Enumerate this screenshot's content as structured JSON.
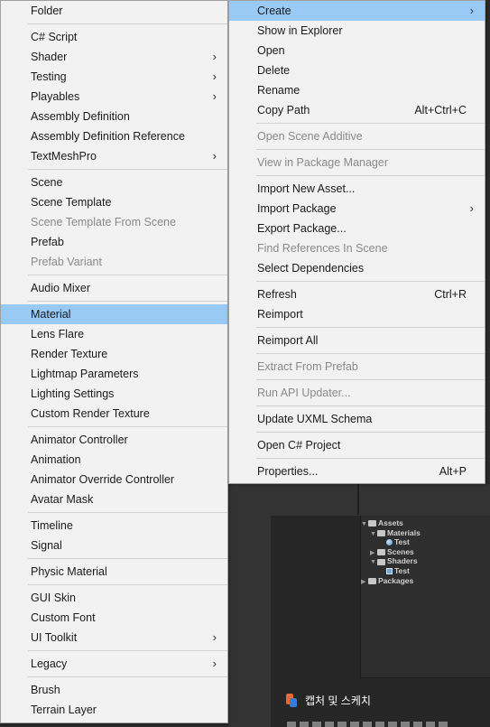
{
  "left_menu": {
    "groups": [
      [
        {
          "label": "Folder"
        }
      ],
      [
        {
          "label": "C# Script"
        },
        {
          "label": "Shader",
          "submenu": true
        },
        {
          "label": "Testing",
          "submenu": true
        },
        {
          "label": "Playables",
          "submenu": true
        },
        {
          "label": "Assembly Definition"
        },
        {
          "label": "Assembly Definition Reference"
        },
        {
          "label": "TextMeshPro",
          "submenu": true
        }
      ],
      [
        {
          "label": "Scene"
        },
        {
          "label": "Scene Template"
        },
        {
          "label": "Scene Template From Scene",
          "disabled": true
        },
        {
          "label": "Prefab"
        },
        {
          "label": "Prefab Variant",
          "disabled": true
        }
      ],
      [
        {
          "label": "Audio Mixer"
        }
      ],
      [
        {
          "label": "Material",
          "selected": true
        },
        {
          "label": "Lens Flare"
        },
        {
          "label": "Render Texture"
        },
        {
          "label": "Lightmap Parameters"
        },
        {
          "label": "Lighting Settings"
        },
        {
          "label": "Custom Render Texture"
        }
      ],
      [
        {
          "label": "Animator Controller"
        },
        {
          "label": "Animation"
        },
        {
          "label": "Animator Override Controller"
        },
        {
          "label": "Avatar Mask"
        }
      ],
      [
        {
          "label": "Timeline"
        },
        {
          "label": "Signal"
        }
      ],
      [
        {
          "label": "Physic Material"
        }
      ],
      [
        {
          "label": "GUI Skin"
        },
        {
          "label": "Custom Font"
        },
        {
          "label": "UI Toolkit",
          "submenu": true
        }
      ],
      [
        {
          "label": "Legacy",
          "submenu": true
        }
      ],
      [
        {
          "label": "Brush"
        },
        {
          "label": "Terrain Layer"
        }
      ]
    ]
  },
  "right_menu": {
    "groups": [
      [
        {
          "label": "Create",
          "submenu": true,
          "selected": true
        },
        {
          "label": "Show in Explorer"
        },
        {
          "label": "Open"
        },
        {
          "label": "Delete"
        },
        {
          "label": "Rename"
        },
        {
          "label": "Copy Path",
          "shortcut": "Alt+Ctrl+C"
        }
      ],
      [
        {
          "label": "Open Scene Additive",
          "disabled": true
        }
      ],
      [
        {
          "label": "View in Package Manager",
          "disabled": true
        }
      ],
      [
        {
          "label": "Import New Asset..."
        },
        {
          "label": "Import Package",
          "submenu": true
        },
        {
          "label": "Export Package..."
        },
        {
          "label": "Find References In Scene",
          "disabled": true
        },
        {
          "label": "Select Dependencies"
        }
      ],
      [
        {
          "label": "Refresh",
          "shortcut": "Ctrl+R"
        },
        {
          "label": "Reimport"
        }
      ],
      [
        {
          "label": "Reimport All"
        }
      ],
      [
        {
          "label": "Extract From Prefab",
          "disabled": true
        }
      ],
      [
        {
          "label": "Run API Updater...",
          "disabled": true
        }
      ],
      [
        {
          "label": "Update UXML Schema"
        }
      ],
      [
        {
          "label": "Open C# Project"
        }
      ],
      [
        {
          "label": "Properties...",
          "shortcut": "Alt+P"
        }
      ]
    ]
  },
  "project_tree": [
    {
      "label": "Assets",
      "arrow": "▼",
      "icon": "folder-icon",
      "indent": 0
    },
    {
      "label": "Materials",
      "arrow": "▼",
      "icon": "folder-icon",
      "indent": 1
    },
    {
      "label": "Test",
      "arrow": "",
      "icon": "material-icon",
      "indent": 2
    },
    {
      "label": "Scenes",
      "arrow": "▶",
      "icon": "folder-icon",
      "indent": 1
    },
    {
      "label": "Shaders",
      "arrow": "▼",
      "icon": "folder-icon",
      "indent": 1
    },
    {
      "label": "Test",
      "arrow": "",
      "icon": "shader-icon",
      "indent": 2
    },
    {
      "label": "Packages",
      "arrow": "▶",
      "icon": "folder-icon",
      "indent": 0
    }
  ],
  "taskbar": {
    "label": "캡처 및 스케치"
  }
}
